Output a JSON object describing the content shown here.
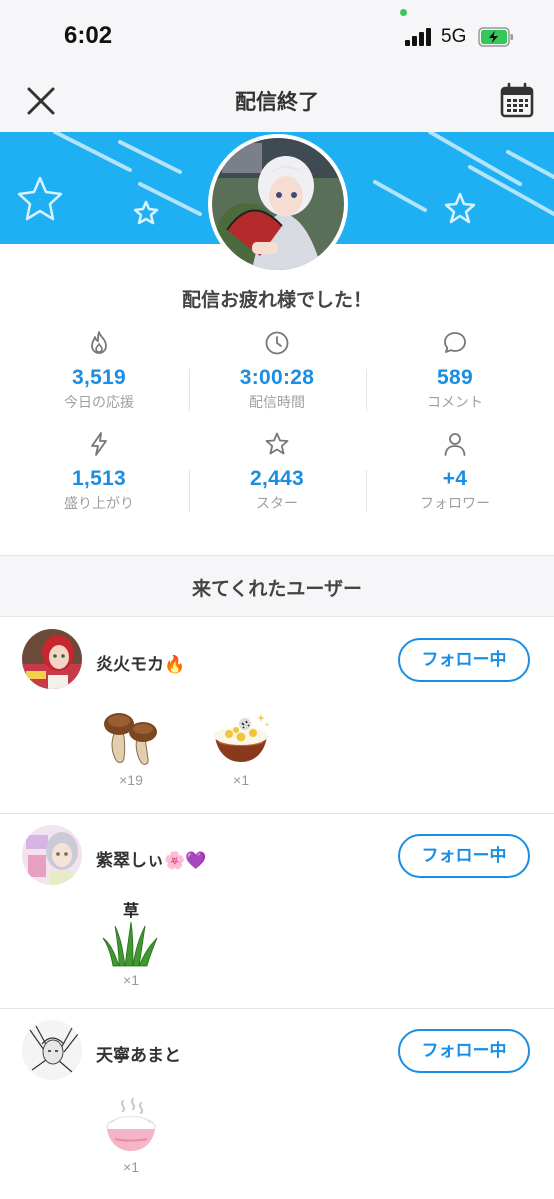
{
  "status": {
    "time": "6:02",
    "network": "5G"
  },
  "header": {
    "title": "配信終了",
    "close_icon": "close-icon",
    "calendar_icon": "calendar-icon"
  },
  "summary": {
    "thanks": "配信お疲れ様でした！",
    "stats": [
      {
        "icon": "flame-icon",
        "value": "3,519",
        "label": "今日の応援"
      },
      {
        "icon": "clock-icon",
        "value": "3:00:28",
        "label": "配信時間"
      },
      {
        "icon": "comment-icon",
        "value": "589",
        "label": "コメント"
      },
      {
        "icon": "lightning-icon",
        "value": "1,513",
        "label": "盛り上がり"
      },
      {
        "icon": "star-icon",
        "value": "2,443",
        "label": "スター"
      },
      {
        "icon": "person-icon",
        "value": "+4",
        "label": "フォロワー"
      }
    ]
  },
  "visitors": {
    "title": "来てくれたユーザー",
    "users": [
      {
        "name": "炎火モカ🔥",
        "follow_label": "フォロー中",
        "gifts": [
          {
            "icon": "mushroom-icon",
            "count": "×19"
          },
          {
            "icon": "rice-bowl-icon",
            "count": "×1"
          }
        ]
      },
      {
        "name": "紫翠しぃ🌸💜",
        "follow_label": "フォロー中",
        "gifts": [
          {
            "icon": "grass-icon",
            "label": "草",
            "count": "×1"
          }
        ]
      },
      {
        "name": "天寧あまと",
        "follow_label": "フォロー中",
        "gifts": [
          {
            "icon": "white-rice-icon",
            "count": "×1"
          }
        ]
      }
    ]
  },
  "colors": {
    "accent": "#1a8ee3",
    "banner": "#1fb0f3",
    "background": "#f6f6f8"
  }
}
